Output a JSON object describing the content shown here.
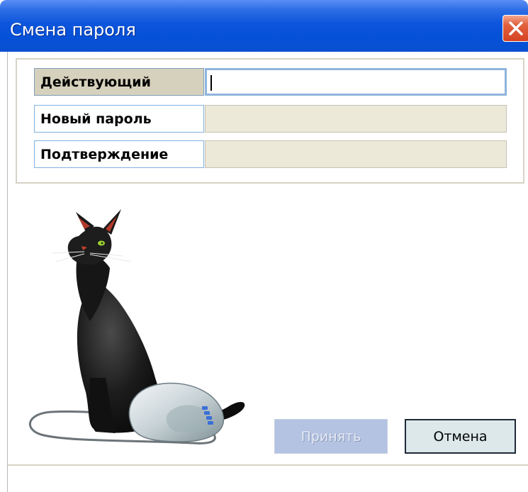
{
  "window": {
    "title": "Смена пароля",
    "close_icon": "close-icon"
  },
  "form": {
    "fields": [
      {
        "label": "Действующий",
        "value": "",
        "active": true
      },
      {
        "label": "Новый пароль",
        "value": "",
        "active": false
      },
      {
        "label": "Подтверждение",
        "value": "",
        "active": false
      }
    ]
  },
  "illustration": {
    "name": "black-cat-with-mouse"
  },
  "buttons": {
    "accept_label": "Принять",
    "cancel_label": "Отмена"
  },
  "colors": {
    "titlebar": "#0551d8",
    "close": "#d54221",
    "active_label_bg": "#d6d1bd",
    "inactive_field_bg": "#ece9d8"
  }
}
